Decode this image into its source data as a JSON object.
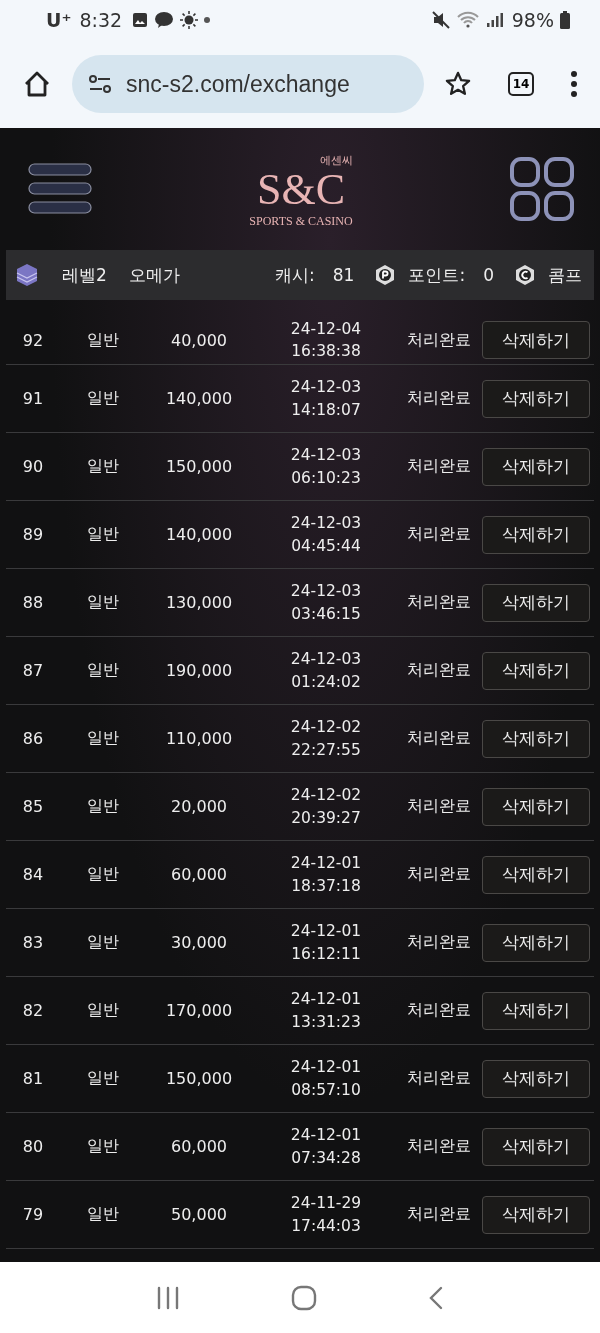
{
  "status_bar": {
    "carrier": "U⁺",
    "time": "8:32",
    "battery": "98%"
  },
  "browser": {
    "url": "snc-s2.com/exchange",
    "tab_count": "14"
  },
  "header": {
    "logo_korean": "에센씨",
    "logo_letters": "S&C",
    "logo_tagline": "SPORTS & CASINO"
  },
  "info_bar": {
    "level": "레벨2",
    "rank": "오메가",
    "cash_label": "캐시:",
    "cash": "81",
    "points_label": "포인트:",
    "points": "0",
    "comp_label": "콤프"
  },
  "rows": [
    {
      "no": "92",
      "type": "일반",
      "amount": "40,000",
      "date": "24-12-04",
      "time": "16:38:38",
      "status": "처리완료",
      "action": "삭제하기"
    },
    {
      "no": "91",
      "type": "일반",
      "amount": "140,000",
      "date": "24-12-03",
      "time": "14:18:07",
      "status": "처리완료",
      "action": "삭제하기"
    },
    {
      "no": "90",
      "type": "일반",
      "amount": "150,000",
      "date": "24-12-03",
      "time": "06:10:23",
      "status": "처리완료",
      "action": "삭제하기"
    },
    {
      "no": "89",
      "type": "일반",
      "amount": "140,000",
      "date": "24-12-03",
      "time": "04:45:44",
      "status": "처리완료",
      "action": "삭제하기"
    },
    {
      "no": "88",
      "type": "일반",
      "amount": "130,000",
      "date": "24-12-03",
      "time": "03:46:15",
      "status": "처리완료",
      "action": "삭제하기"
    },
    {
      "no": "87",
      "type": "일반",
      "amount": "190,000",
      "date": "24-12-03",
      "time": "01:24:02",
      "status": "처리완료",
      "action": "삭제하기"
    },
    {
      "no": "86",
      "type": "일반",
      "amount": "110,000",
      "date": "24-12-02",
      "time": "22:27:55",
      "status": "처리완료",
      "action": "삭제하기"
    },
    {
      "no": "85",
      "type": "일반",
      "amount": "20,000",
      "date": "24-12-02",
      "time": "20:39:27",
      "status": "처리완료",
      "action": "삭제하기"
    },
    {
      "no": "84",
      "type": "일반",
      "amount": "60,000",
      "date": "24-12-01",
      "time": "18:37:18",
      "status": "처리완료",
      "action": "삭제하기"
    },
    {
      "no": "83",
      "type": "일반",
      "amount": "30,000",
      "date": "24-12-01",
      "time": "16:12:11",
      "status": "처리완료",
      "action": "삭제하기"
    },
    {
      "no": "82",
      "type": "일반",
      "amount": "170,000",
      "date": "24-12-01",
      "time": "13:31:23",
      "status": "처리완료",
      "action": "삭제하기"
    },
    {
      "no": "81",
      "type": "일반",
      "amount": "150,000",
      "date": "24-12-01",
      "time": "08:57:10",
      "status": "처리완료",
      "action": "삭제하기"
    },
    {
      "no": "80",
      "type": "일반",
      "amount": "60,000",
      "date": "24-12-01",
      "time": "07:34:28",
      "status": "처리완료",
      "action": "삭제하기"
    },
    {
      "no": "79",
      "type": "일반",
      "amount": "50,000",
      "date": "24-11-29",
      "time": "17:44:03",
      "status": "처리완료",
      "action": "삭제하기"
    }
  ]
}
